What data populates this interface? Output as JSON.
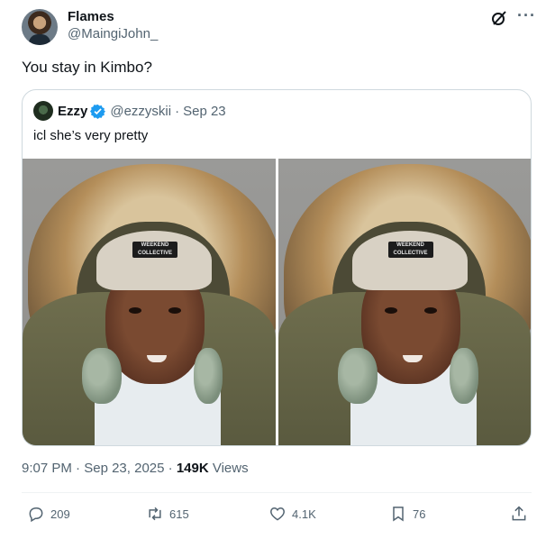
{
  "author": {
    "display_name": "Flames",
    "handle": "@MaingiJohn_"
  },
  "tweet_text": "You stay in Kimbo?",
  "quoted": {
    "display_name": "Ezzy",
    "handle": "@ezzyskii",
    "separator": "·",
    "date": "Sep 23",
    "text": "icl she’s very pretty",
    "beanie_text": "WEEKEND COLLECTIVE"
  },
  "meta": {
    "time": "9:07 PM",
    "separator": " · ",
    "date": "Sep 23, 2025",
    "views_count": "149K",
    "views_label": " Views"
  },
  "actions": {
    "replies": "209",
    "reposts": "615",
    "likes": "4.1K",
    "bookmarks": "76"
  },
  "icons": {
    "grok": "grok-icon",
    "more": "more-icon",
    "verified": "verified-icon",
    "reply": "reply-icon",
    "repost": "repost-icon",
    "like": "heart-icon",
    "bookmark": "bookmark-icon",
    "share": "share-icon"
  },
  "colors": {
    "text_primary": "#0f1419",
    "text_secondary": "#536471",
    "border": "#cfd9de",
    "verified_blue": "#1d9bf0"
  }
}
